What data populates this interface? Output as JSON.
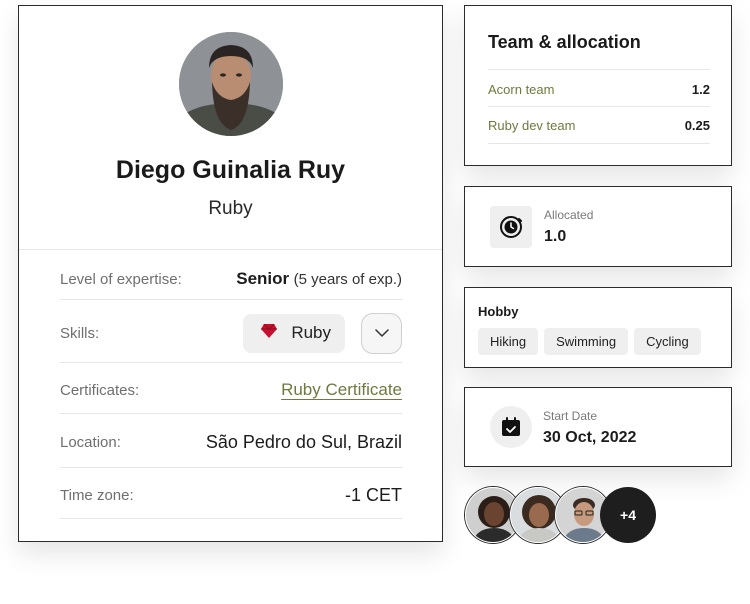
{
  "profile": {
    "name": "Diego Guinalia Ruy",
    "role": "Ruby",
    "expertise": {
      "label": "Level of expertise:",
      "level": "Senior",
      "years": "(5 years of exp.)"
    },
    "skills": {
      "label": "Skills:",
      "selected": "Ruby"
    },
    "certificates": {
      "label": "Certificates:",
      "value": "Ruby Certificate"
    },
    "location": {
      "label": "Location:",
      "value": "São Pedro do Sul, Brazil"
    },
    "timezone": {
      "label": "Time zone:",
      "value": "-1 CET"
    }
  },
  "team": {
    "title": "Team & allocation",
    "rows": [
      {
        "name": "Acorn team",
        "value": "1.2"
      },
      {
        "name": "Ruby dev team",
        "value": "0.25"
      }
    ]
  },
  "allocated": {
    "label": "Allocated",
    "value": "1.0"
  },
  "hobby": {
    "title": "Hobby",
    "tags": [
      "Hiking",
      "Swimming",
      "Cycling"
    ]
  },
  "start_date": {
    "label": "Start Date",
    "value": "30 Oct, 2022"
  },
  "avatars": {
    "more_label": "+4"
  },
  "colors": {
    "accent_olive": "#6e7a3e",
    "ruby_red": "#c8102e",
    "text_dark": "#1c1c1c"
  },
  "icons": [
    "ruby-gem-icon",
    "chevron-down-icon",
    "clock-icon",
    "calendar-check-icon"
  ]
}
